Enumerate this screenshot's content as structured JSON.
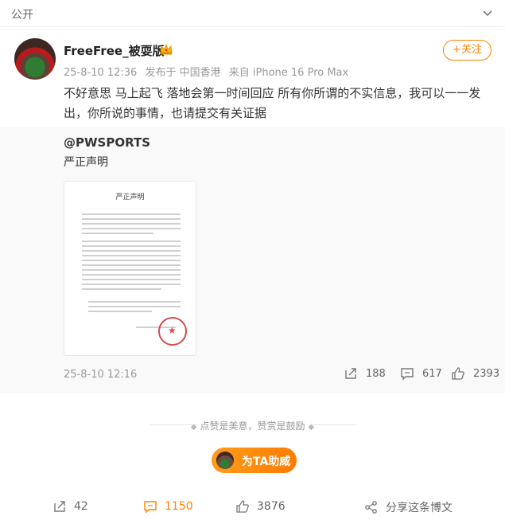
{
  "topbar": {
    "visibility": "公开"
  },
  "post": {
    "username": "FreeFree_被耍版",
    "timestamp": "25-8-10 12:36",
    "location": "发布于 中国香港",
    "device": "来自 iPhone 16 Pro Max",
    "follow_label": "+关注",
    "text": "不好意思 马上起飞 落地会第一时间回应 所有你所谓的不实信息，我可以一一发出，你所说的事情，也请提交有关证据"
  },
  "repost": {
    "author": "@PWSPORTS",
    "text": "严正声明",
    "doc_title": "严正声明",
    "timestamp": "25-8-10 12:16",
    "shares": "188",
    "comments": "617",
    "likes": "2393"
  },
  "reward": {
    "tip_text": "点赞是美意，赞赏是鼓励",
    "boost_label": "为TA助威"
  },
  "footer": {
    "shares": "42",
    "comments": "1150",
    "likes": "3876",
    "share_label": "分享这条博文"
  },
  "colors": {
    "accent": "#ff8200",
    "muted": "#999999",
    "seal": "#d84a4a"
  }
}
